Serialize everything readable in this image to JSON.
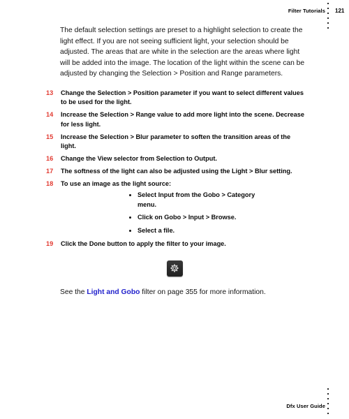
{
  "header": {
    "title": "Filter Tutorials",
    "page_number": "121",
    "rule": "dotted-vertical-rule"
  },
  "body": {
    "intro_paragraph": "The default selection settings are preset to a highlight selection to create the light effect. If you are not seeing sufficient light, your selection should be adjusted. The areas that are white in the selection are the areas where light will be added into the image. The location of the light within the scene can be adjusted by changing the Selection > Position and Range parameters.",
    "steps": [
      {
        "number": "13",
        "text": "Change the Selection > Position parameter if you want to select different values to be used for the light."
      },
      {
        "number": "14",
        "text": "Increase the Selection > Range value to add more light into the scene. Decrease for less light."
      },
      {
        "number": "15",
        "text": "Increase the Selection > Blur parameter to soften the transition areas of the light."
      },
      {
        "number": "16",
        "text": "Change the View selector from Selection to Output."
      },
      {
        "number": "17",
        "text": "The softness of the light can also be adjusted using the Light > Blur setting."
      },
      {
        "number": "18",
        "text": "To use an image as the light source:",
        "subitems": [
          "Select Input from the Gobo > Category menu.",
          "Click on Gobo > Input > Browse.",
          "Select a file."
        ]
      },
      {
        "number": "19",
        "text": "Click the Done button to apply the filter to your image."
      }
    ],
    "figure": {
      "icon": "gear-icon",
      "alt_label": "Settings gear button"
    },
    "crossref": {
      "prefix": "See the ",
      "link_text": "Light and Gobo",
      "suffix": " filter on page 355 for more information."
    }
  },
  "footer": {
    "title": "Dfx User Guide",
    "rule": "dotted-vertical-rule"
  },
  "colors": {
    "step_number_red": "#e23b32",
    "link_blue": "#2222cc",
    "body_text": "#131313",
    "gear_button_dark": "#2a2a2a",
    "page_background": "#ffffff"
  }
}
